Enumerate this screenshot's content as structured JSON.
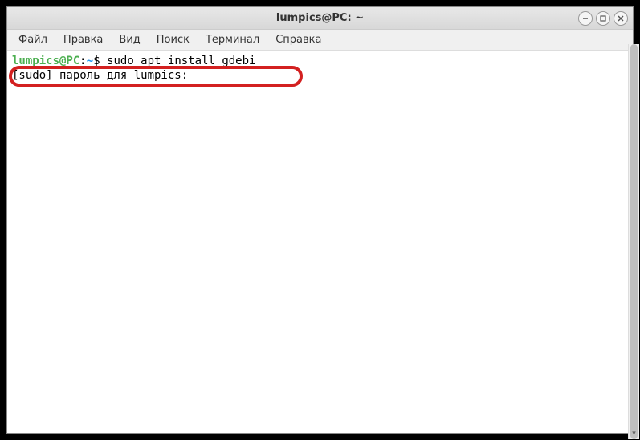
{
  "window": {
    "title": "lumpics@PC: ~"
  },
  "menu": {
    "file": "Файл",
    "edit": "Правка",
    "view": "Вид",
    "search": "Поиск",
    "terminal": "Терминал",
    "help": "Справка"
  },
  "terminal": {
    "prompt_user": "lumpics@PC",
    "prompt_sep": ":",
    "prompt_path": "~",
    "prompt_dollar": "$ ",
    "command": "sudo apt install gdebi",
    "sudo_prompt": "[sudo] пароль для lumpics: "
  },
  "controls": {
    "minimize": "–",
    "maximize": "⬜",
    "close": "✕"
  }
}
